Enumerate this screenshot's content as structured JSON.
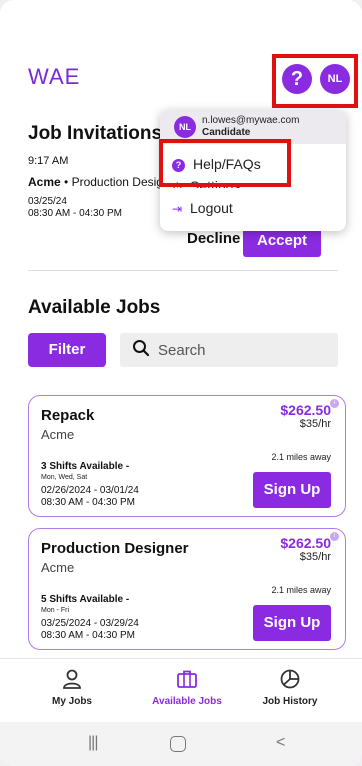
{
  "header": {
    "logo": "WAE",
    "help_icon": "?",
    "avatar_initials": "NL"
  },
  "menu": {
    "avatar_initials": "NL",
    "email": "n.lowes@mywae.com",
    "role": "Candidate",
    "items": [
      {
        "label": "Help/FAQs",
        "icon": "help-circle-icon"
      },
      {
        "label": "Settings",
        "icon": "settings-icon"
      },
      {
        "label": "Logout",
        "icon": "logout-icon"
      }
    ]
  },
  "invitations": {
    "title": "Job Invitations",
    "time": "9:17 AM",
    "company": "Acme",
    "separator": "•",
    "role": "Production Designer",
    "date": "03/25/24",
    "hours": "08:30 AM - 04:30 PM",
    "decline_label": "Decline",
    "accept_label": "Accept"
  },
  "available": {
    "title": "Available Jobs",
    "filter_label": "Filter",
    "search_placeholder": "Search",
    "jobs": [
      {
        "title": "Repack",
        "company": "Acme",
        "pay": "$262.50",
        "rate": "$35/hr",
        "shifts": "3 Shifts Available -",
        "days": "Mon, Wed, Sat",
        "dates": "02/26/2024 - 03/01/24",
        "hours": "08:30 AM - 04:30 PM",
        "distance": "2.1 miles away",
        "signup_label": "Sign Up"
      },
      {
        "title": "Production Designer",
        "company": "Acme",
        "pay": "$262.50",
        "rate": "$35/hr",
        "shifts": "5 Shifts Available -",
        "days": "Mon - Fri",
        "dates": "03/25/2024 - 03/29/24",
        "hours": "08:30 AM - 04:30 PM",
        "distance": "2.1 miles away",
        "signup_label": "Sign Up"
      }
    ]
  },
  "nav": {
    "items": [
      {
        "label": "My Jobs",
        "icon": "person-icon"
      },
      {
        "label": "Available Jobs",
        "icon": "briefcase-icon",
        "active": true
      },
      {
        "label": "Job History",
        "icon": "pie-chart-icon"
      }
    ]
  },
  "colors": {
    "accent": "#8a2be2",
    "highlight": "#e01010"
  }
}
